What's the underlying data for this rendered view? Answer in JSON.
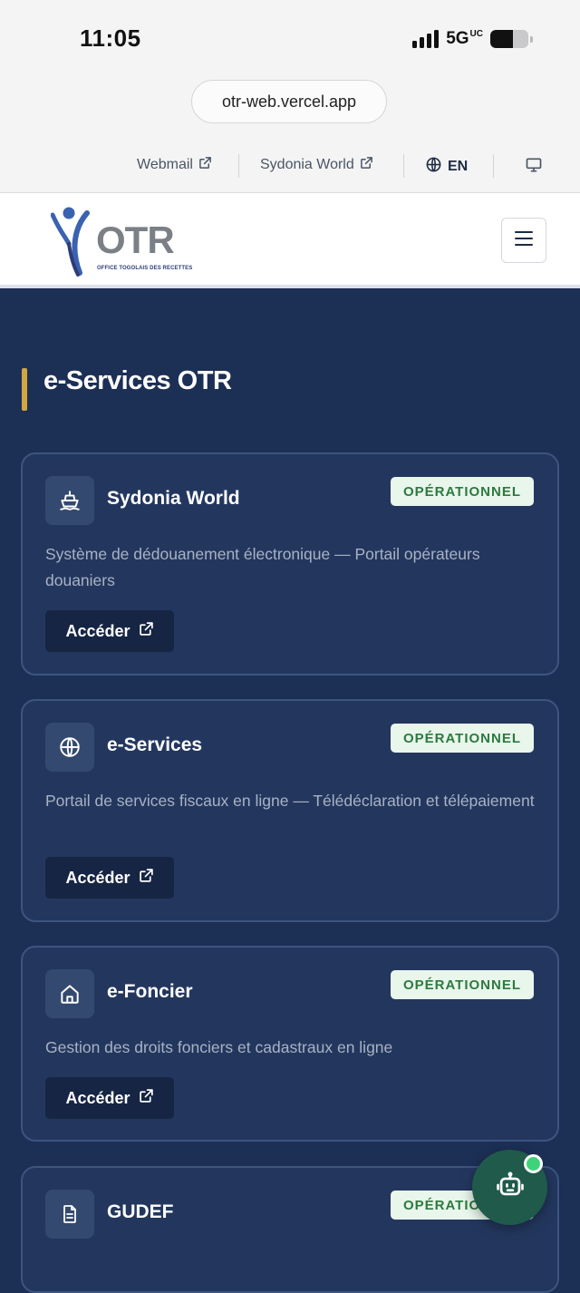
{
  "status_bar": {
    "time": "11:05",
    "network": "5G",
    "network_suffix": "UC",
    "battery_level": 0.6
  },
  "browser": {
    "url": "otr-web.vercel.app"
  },
  "top_links": [
    {
      "label": "Webmail",
      "icon": "external-link-icon"
    },
    {
      "label": "Sydonia World",
      "icon": "external-link-icon"
    }
  ],
  "language": {
    "label": "EN",
    "icon": "globe-icon"
  },
  "header": {
    "logo_text": "OTR",
    "logo_subtitle": "OFFICE TOGOLAIS DES RECETTES",
    "menu_icon": "hamburger-icon"
  },
  "section": {
    "title": "e-Services OTR"
  },
  "services": [
    {
      "title": "Sydonia World",
      "status": "OPÉRATIONNEL",
      "description": "Système de dédouanement électronique — Portail opérateurs douaniers",
      "button": "Accéder",
      "icon": "ship-icon"
    },
    {
      "title": "e-Services",
      "status": "OPÉRATIONNEL",
      "description": "Portail de services fiscaux en ligne — Télédéclaration et télépaiement",
      "button": "Accéder",
      "icon": "globe-icon"
    },
    {
      "title": "e-Foncier",
      "status": "OPÉRATIONNEL",
      "description": "Gestion des droits fonciers et cadastraux en ligne",
      "button": "Accéder",
      "icon": "home-icon"
    },
    {
      "title": "GUDEF",
      "status": "OPÉRATIONNEL",
      "icon": "document-icon"
    }
  ],
  "chatbot": {
    "icon": "robot-icon",
    "online": true
  },
  "colors": {
    "background": "#1c2f55",
    "card": "#23375e",
    "accent": "#d2a640",
    "badge_bg": "#e9f6ec",
    "badge_text": "#2c7a3e",
    "fab": "#1f5a4a"
  }
}
